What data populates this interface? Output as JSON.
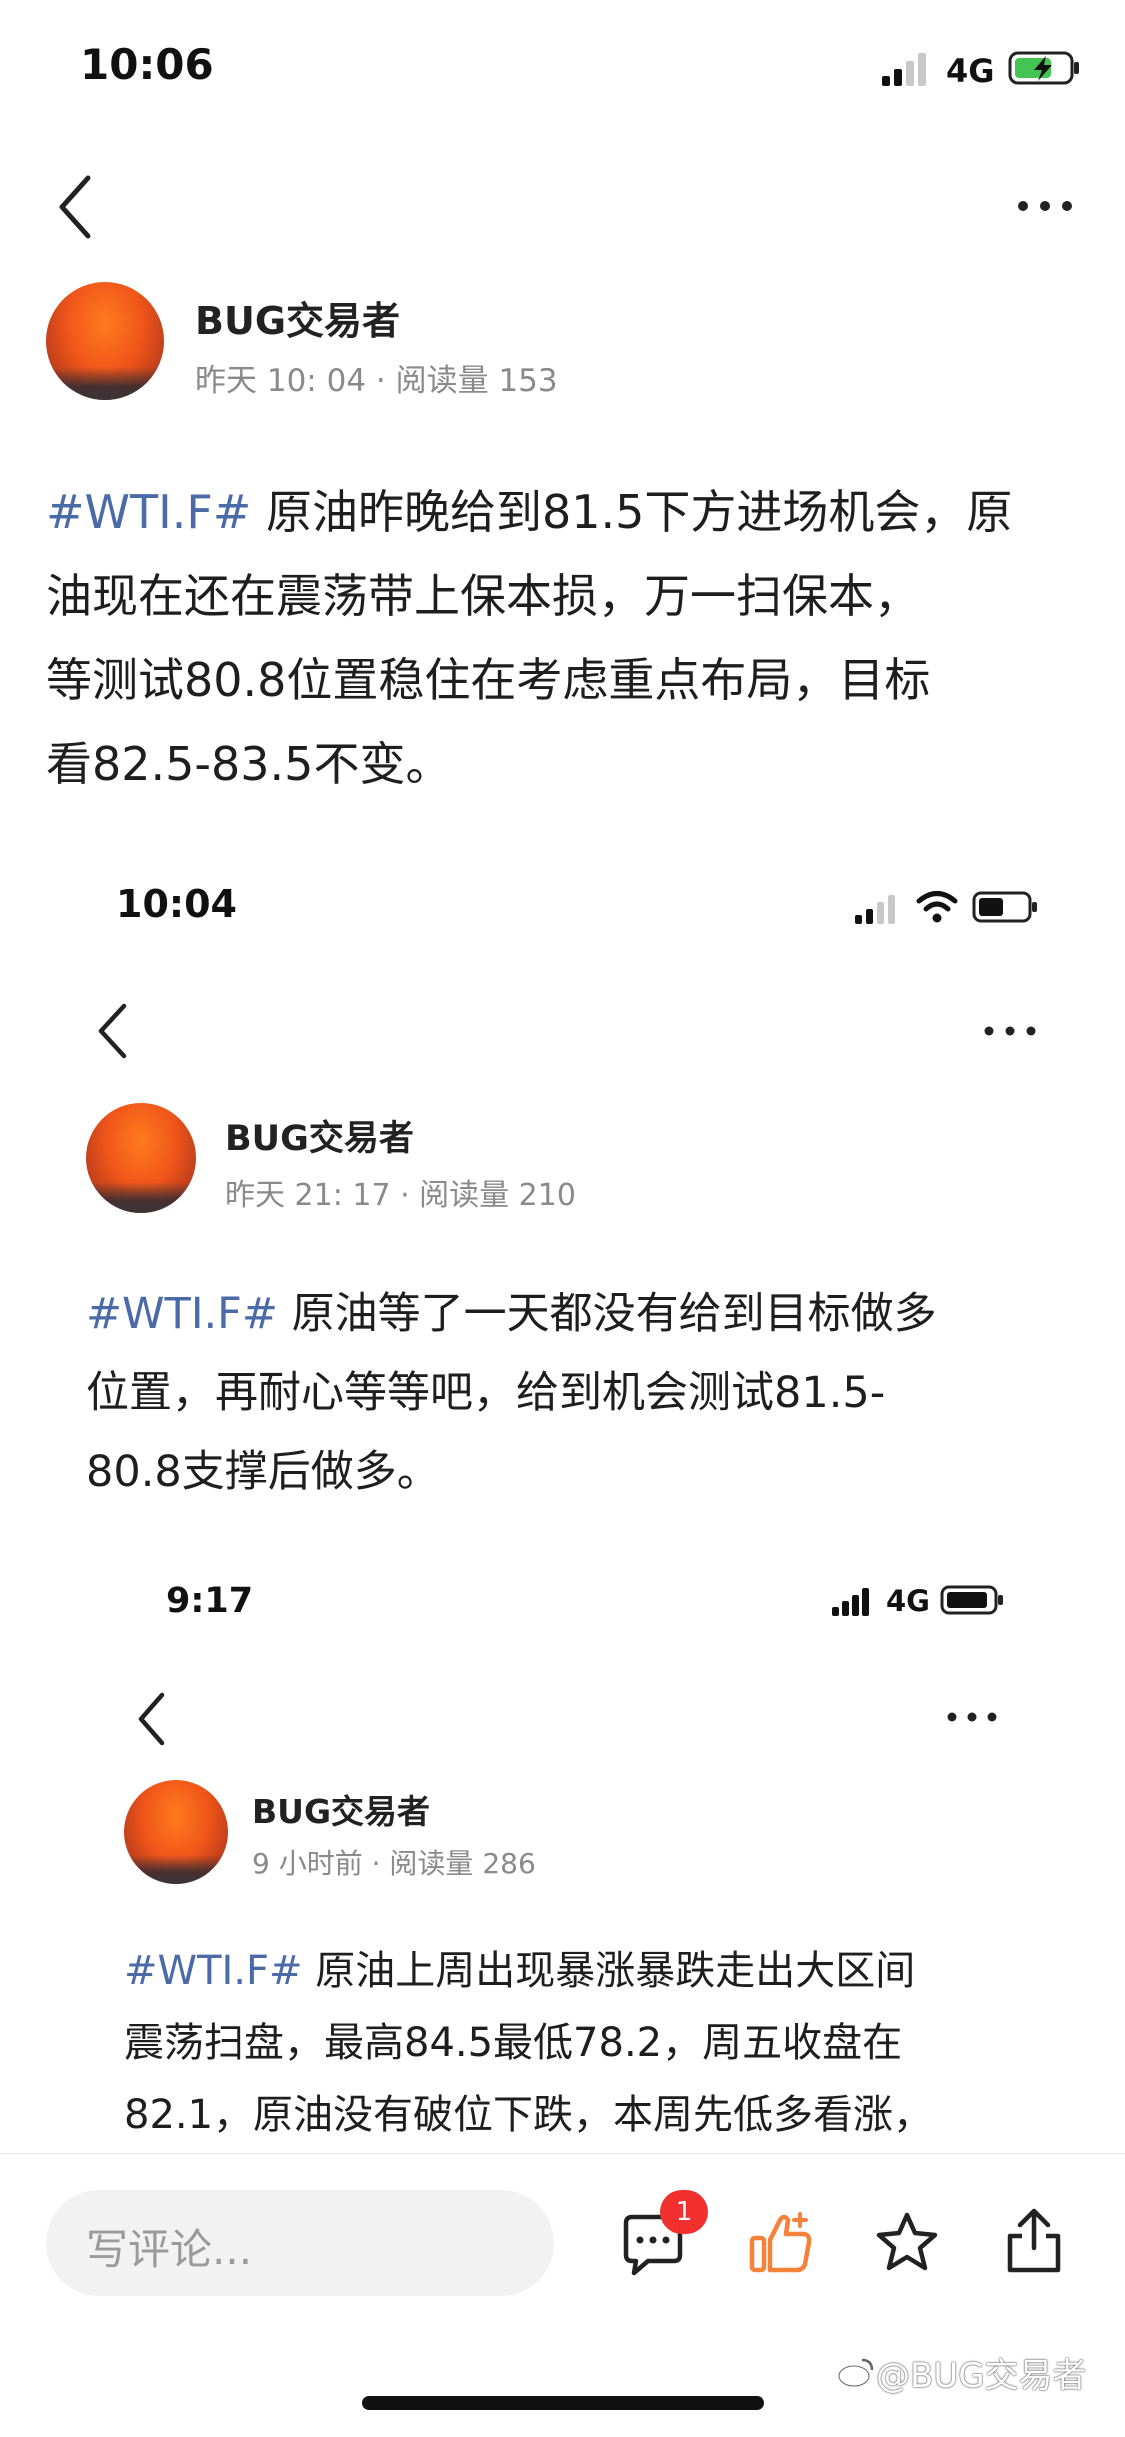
{
  "screens": [
    {
      "status_time": "10:06",
      "network": "4G",
      "author": "BUG交易者",
      "meta": "昨天 10: 04 · 阅读量 153",
      "tag": "#WTI.F#",
      "lines": [
        " 原油昨晚给到81.5下方进场机会，原",
        "油现在还在震荡带上保本损，万一扫保本，",
        "等测试80.8位置稳住在考虑重点布局，目标",
        "看82.5-83.5不变。"
      ]
    },
    {
      "status_time": "10:04",
      "author": "BUG交易者",
      "meta": "昨天 21: 17 · 阅读量 210",
      "tag": "#WTI.F#",
      "lines": [
        " 原油等了一天都没有给到目标做多",
        "位置，再耐心等等吧，给到机会测试81.5-",
        "80.8支撑后做多。"
      ]
    },
    {
      "status_time": "9:17",
      "network": "4G",
      "author": "BUG交易者",
      "meta": "9 小时前 · 阅读量 286",
      "tag": "#WTI.F#",
      "lines": [
        " 原油上周出现暴涨暴跌走出大区间",
        "震荡扫盘，最高84.5最低78.2，周五收盘在",
        "82.1，原油没有破位下跌，本周先低多看涨，"
      ]
    }
  ],
  "bottom": {
    "comment_placeholder": "写评论...",
    "comment_badge": "1",
    "watermark": "@BUG交易者"
  },
  "icons": {
    "back": "chevron-left-icon",
    "more": "more-dots-icon",
    "comment": "comment-icon",
    "like": "thumbs-up-icon",
    "favorite": "star-icon",
    "share": "share-icon"
  },
  "colors": {
    "hashtag": "#4a6aa8",
    "like_orange": "#f5823a",
    "badge_red": "#f23030"
  }
}
